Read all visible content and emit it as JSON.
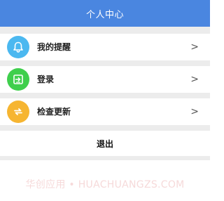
{
  "header": {
    "title": "个人中心",
    "color": "#4a86e0"
  },
  "menu": {
    "items": [
      {
        "label": "我的提醒",
        "icon": "bell-icon",
        "icon_color": "#4bb8f0",
        "chevron": ">"
      },
      {
        "label": "登录",
        "icon": "login-icon",
        "icon_color": "#3fcf4c",
        "chevron": ">"
      },
      {
        "label": "检查更新",
        "icon": "refresh-icon",
        "icon_color": "#f6b531",
        "chevron": ">"
      }
    ]
  },
  "logout": {
    "label": "退出"
  },
  "watermark": {
    "text": "华创应用 • HUACHUANGZS.COM"
  }
}
